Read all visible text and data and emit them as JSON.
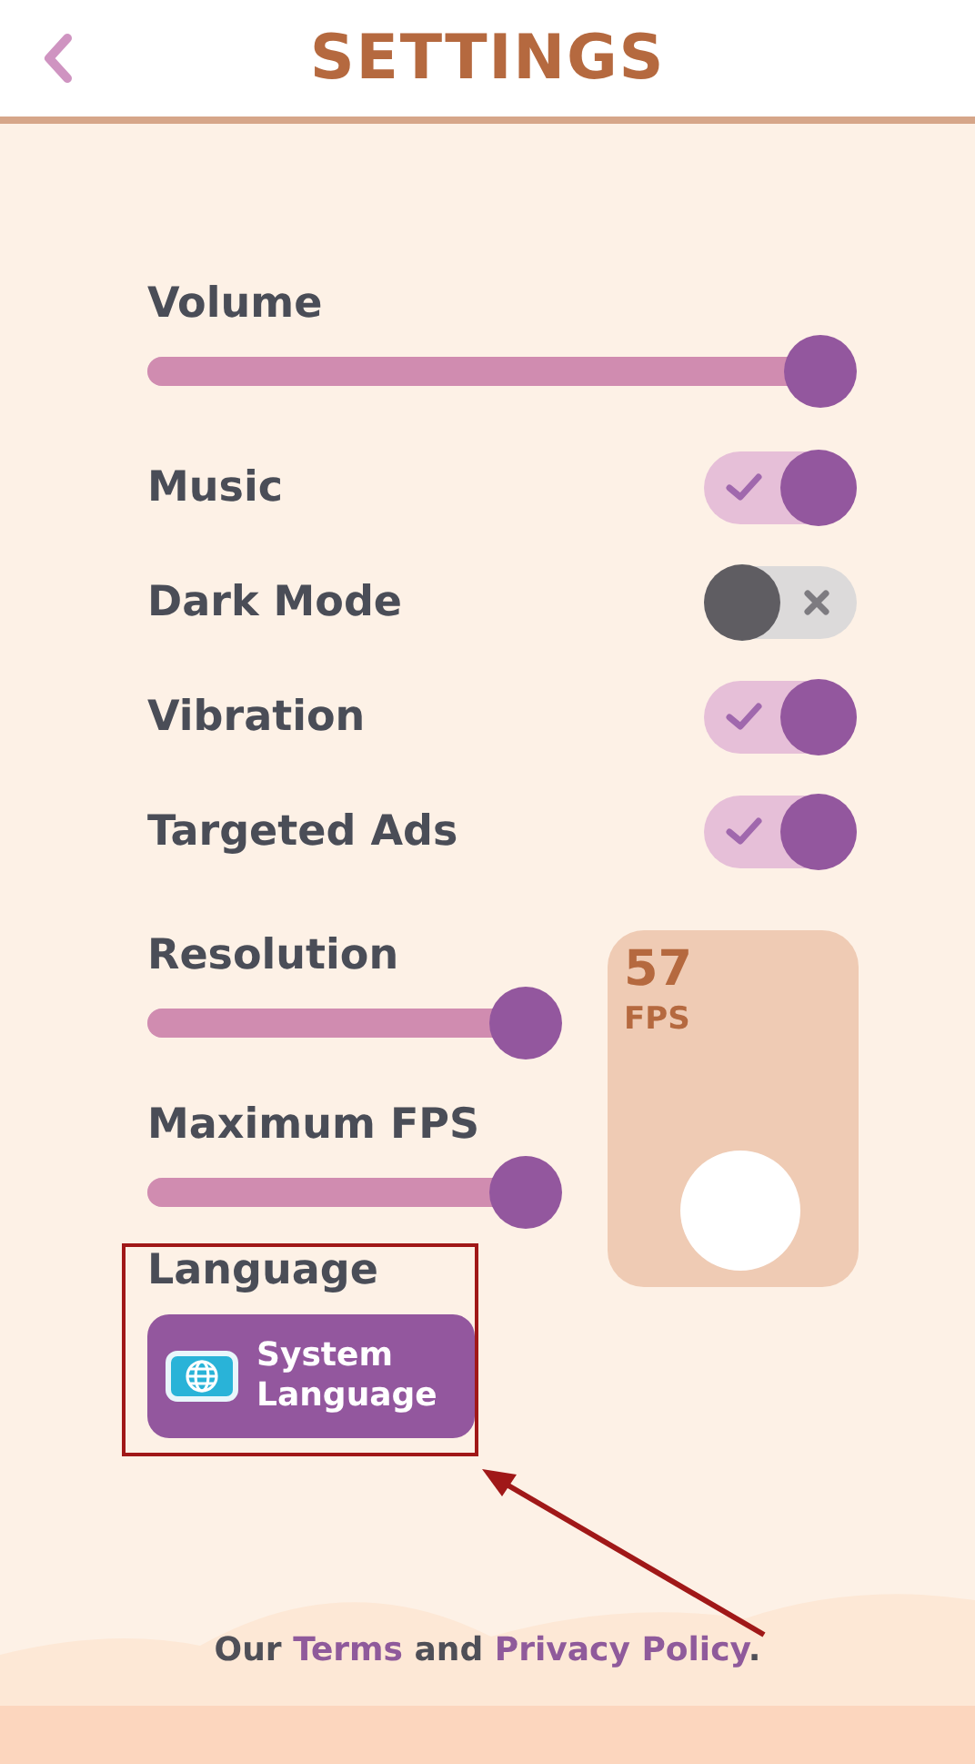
{
  "header": {
    "title": "SETTINGS"
  },
  "volume": {
    "label": "Volume",
    "level": 1
  },
  "toggles": [
    {
      "label": "Music",
      "on": true
    },
    {
      "label": "Dark Mode",
      "on": false
    },
    {
      "label": "Vibration",
      "on": true
    },
    {
      "label": "Targeted Ads",
      "on": true
    }
  ],
  "resolution": {
    "label": "Resolution",
    "level": 1
  },
  "max_fps": {
    "label": "Maximum FPS",
    "level": 1
  },
  "fps_panel": {
    "value": "57",
    "unit": "FPS"
  },
  "language": {
    "label": "Language",
    "button": "System Language"
  },
  "footer": [
    {
      "kind": "text",
      "text": "Our "
    },
    {
      "kind": "link",
      "text": "Terms"
    },
    {
      "kind": "text",
      "text": " and "
    },
    {
      "kind": "link",
      "text": "Privacy Policy"
    },
    {
      "kind": "text",
      "text": "."
    }
  ]
}
